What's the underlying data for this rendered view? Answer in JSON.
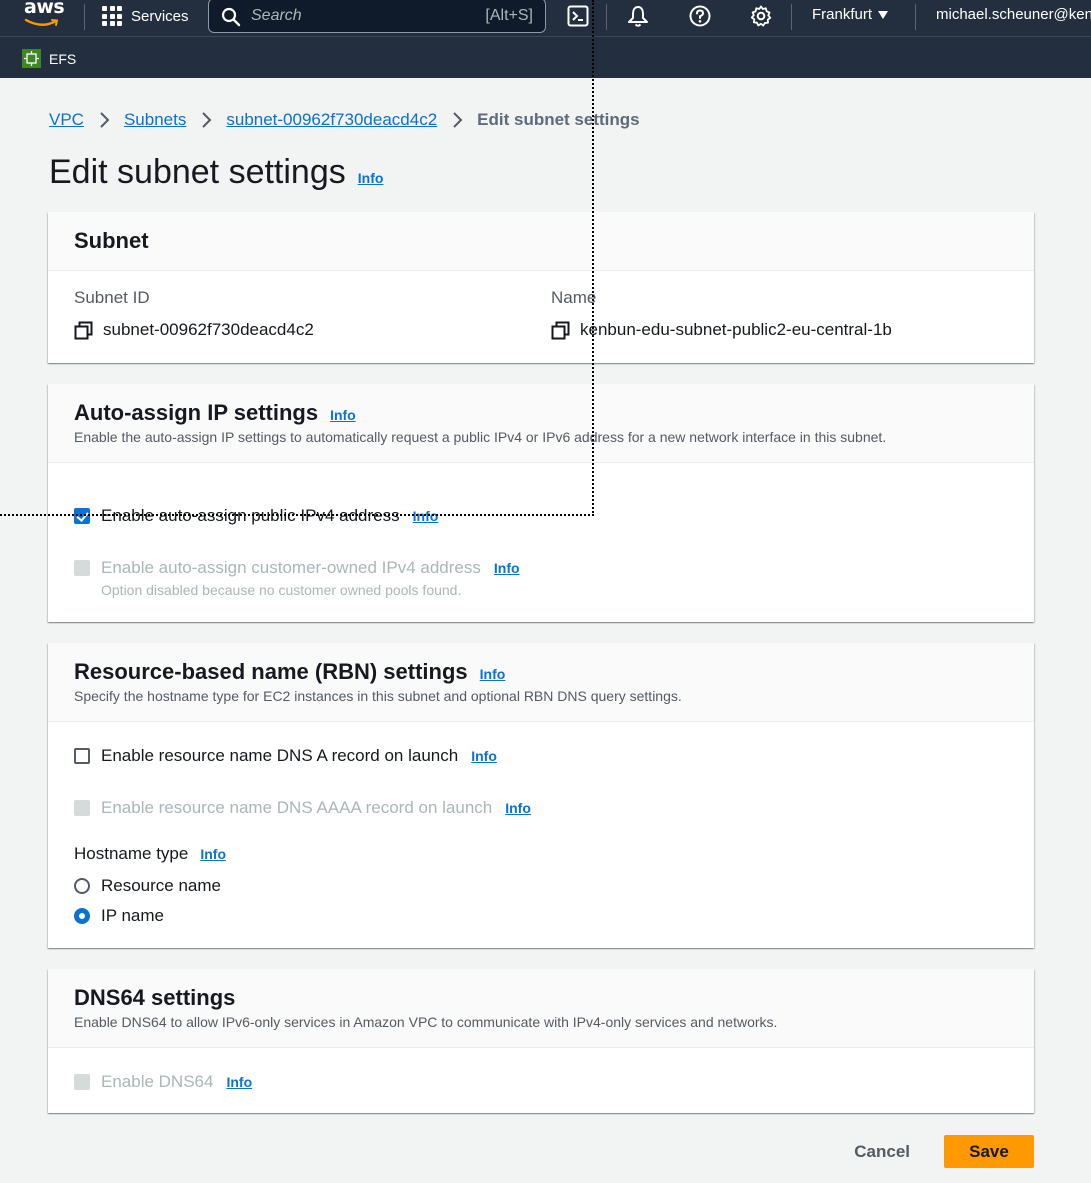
{
  "nav": {
    "logo_text": "aws",
    "services_label": "Services",
    "search_placeholder": "Search",
    "search_shortcut": "[Alt+S]",
    "region": "Frankfurt",
    "user": "michael.scheuner@ken",
    "favorite": "EFS"
  },
  "breadcrumb": {
    "items": [
      "VPC",
      "Subnets",
      "subnet-00962f730deacd4c2"
    ],
    "current": "Edit subnet settings"
  },
  "page": {
    "title": "Edit subnet settings",
    "info": "Info"
  },
  "subnet": {
    "title": "Subnet",
    "id_label": "Subnet ID",
    "id_value": "subnet-00962f730deacd4c2",
    "name_label": "Name",
    "name_value": "kenbun-edu-subnet-public2-eu-central-1b"
  },
  "auto_assign": {
    "title": "Auto-assign IP settings",
    "info": "Info",
    "description": "Enable the auto-assign IP settings to automatically request a public IPv4 or IPv6 address for a new network interface in this subnet.",
    "public_ipv4_label": "Enable auto-assign public IPv4 address",
    "public_ipv4_checked": true,
    "customer_owned_label": "Enable auto-assign customer-owned IPv4 address",
    "customer_owned_note": "Option disabled because no customer owned pools found."
  },
  "rbn": {
    "title": "Resource-based name (RBN) settings",
    "info": "Info",
    "description": "Specify the hostname type for EC2 instances in this subnet and optional RBN DNS query settings.",
    "dns_a_label": "Enable resource name DNS A record on launch",
    "dns_aaaa_label": "Enable resource name DNS AAAA record on launch",
    "hostname_label": "Hostname type",
    "hostname_options": [
      "Resource name",
      "IP name"
    ],
    "hostname_selected": "IP name"
  },
  "dns64": {
    "title": "DNS64 settings",
    "description": "Enable DNS64 to allow IPv6-only services in Amazon VPC to communicate with IPv4-only services and networks.",
    "enable_label": "Enable DNS64",
    "info": "Info"
  },
  "actions": {
    "cancel": "Cancel",
    "save": "Save"
  },
  "colors": {
    "nav_bg": "#232f3e",
    "link": "#0972d3",
    "primary": "#ff9900"
  }
}
